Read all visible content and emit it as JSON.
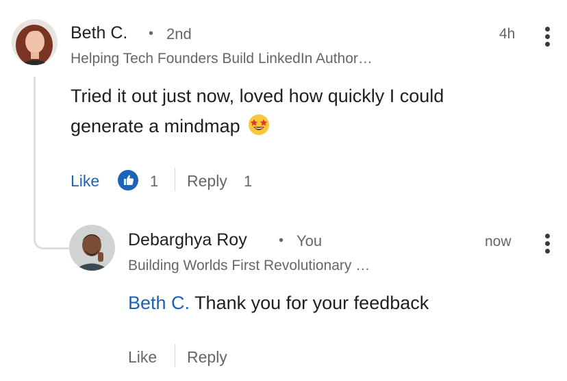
{
  "comment": {
    "author_name": "Beth C.",
    "degree": "2nd",
    "headline": "Helping Tech Founders Build LinkedIn Author…",
    "time": "4h",
    "text": "Tried it out just now, loved how quickly I could generate a mindmap",
    "emoji": "star-struck-emoji",
    "like_label": "Like",
    "like_count": "1",
    "reply_label": "Reply",
    "reply_count": "1"
  },
  "reply": {
    "author_name": "Debarghya Roy",
    "degree": "You",
    "headline": "Building Worlds First Revolutionary …",
    "time": "now",
    "mention": "Beth C.",
    "text": "Thank you for your feedback",
    "like_label": "Like",
    "reply_label": "Reply"
  },
  "separator": "•",
  "colors": {
    "accent": "#1d63b8",
    "muted_text": "#666666",
    "primary_text": "#1f1f1f"
  }
}
